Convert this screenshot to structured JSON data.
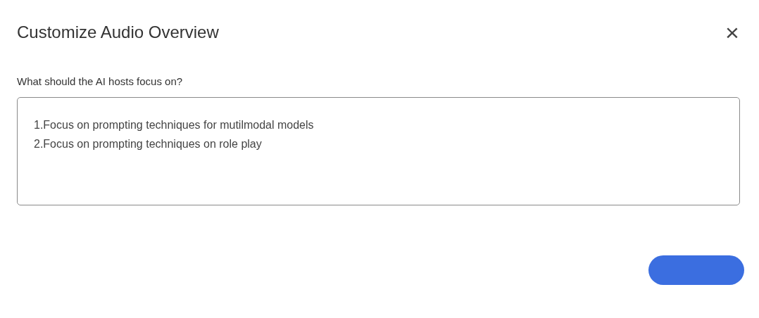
{
  "dialog": {
    "title": "Customize Audio Overview",
    "close": "×"
  },
  "focus_field": {
    "label": "What should the AI hosts focus on?",
    "value": "1.Focus on prompting techniques for mutilmodal models\n2.Focus on prompting techniques on role play"
  }
}
